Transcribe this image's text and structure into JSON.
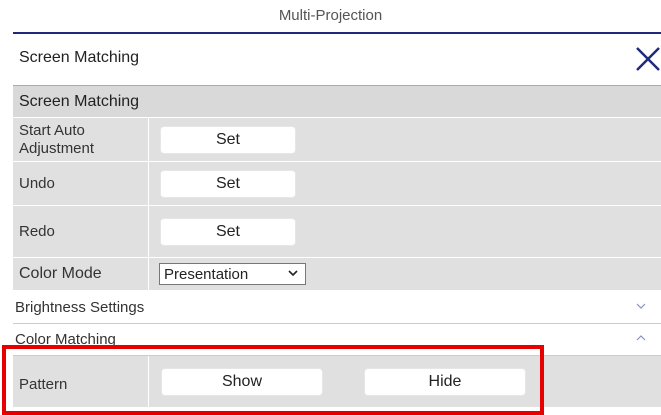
{
  "window": {
    "title": "Multi-Projection"
  },
  "panel": {
    "title": "Screen Matching"
  },
  "section": {
    "title": "Screen Matching"
  },
  "rows": {
    "start_auto": {
      "label": "Start Auto Adjustment",
      "button": "Set"
    },
    "undo": {
      "label": "Undo",
      "button": "Set"
    },
    "redo": {
      "label": "Redo",
      "button": "Set"
    },
    "color_mode": {
      "label": "Color Mode",
      "value": "Presentation"
    }
  },
  "brightness": {
    "title": "Brightness Settings",
    "state": "collapsed"
  },
  "color_matching": {
    "title": "Color Matching",
    "state": "expanded"
  },
  "pattern": {
    "label": "Pattern",
    "show": "Show",
    "hide": "Hide"
  },
  "icons": {
    "close": "close-icon",
    "dropdown": "chevron-down-icon",
    "expand": "chevron-down-icon",
    "collapse": "chevron-up-icon"
  },
  "colors": {
    "accent": "#1f2a7a",
    "highlight": "#e60000",
    "row_bg": "#e0e0e0"
  }
}
